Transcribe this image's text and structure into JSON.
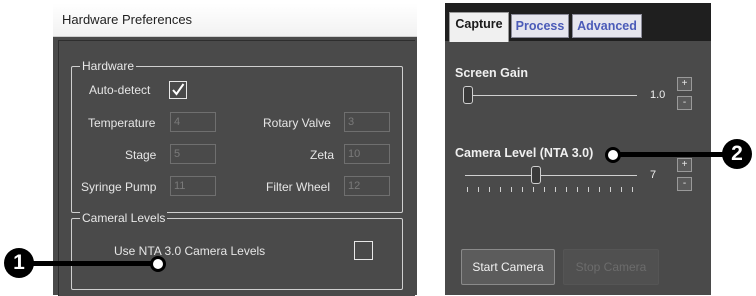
{
  "hardware_prefs": {
    "title": "Hardware Preferences",
    "hardware_group": {
      "legend": "Hardware",
      "auto_detect_label": "Auto-detect",
      "auto_detect_checked": true,
      "fields": [
        {
          "label": "Temperature",
          "value": "4"
        },
        {
          "label": "Stage",
          "value": "5"
        },
        {
          "label": "Syringe Pump",
          "value": "11"
        },
        {
          "label": "Rotary Valve",
          "value": "3"
        },
        {
          "label": "Zeta",
          "value": "10"
        },
        {
          "label": "Filter Wheel",
          "value": "12"
        }
      ]
    },
    "camera_group": {
      "legend": "Cameral Levels",
      "option_label": "Use NTA 3.0 Camera Levels",
      "checked": false
    }
  },
  "capture_panel": {
    "tabs": [
      {
        "label": "Capture",
        "active": true
      },
      {
        "label": "Process",
        "active": false
      },
      {
        "label": "Advanced",
        "active": false
      }
    ],
    "screen_gain": {
      "label": "Screen Gain",
      "value": "1.0"
    },
    "camera_level": {
      "label": "Camera Level (NTA 3.0)",
      "value": "7"
    },
    "spin_up": "+",
    "spin_down": "-",
    "start_button": "Start Camera",
    "stop_button": "Stop Camera"
  },
  "callouts": {
    "one": "1",
    "two": "2"
  },
  "colors": {
    "panel_bg": "#4a4a4a",
    "tab_inactive_text": "#4b5bb8",
    "callout": "#000000"
  }
}
